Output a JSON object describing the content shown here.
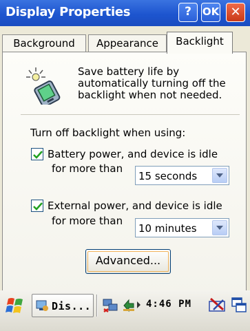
{
  "window": {
    "title": "Display Properties",
    "help_label": "?",
    "ok_label": "OK",
    "close_label": "✕"
  },
  "tabs": [
    {
      "label": "Background",
      "active": false
    },
    {
      "label": "Appearance",
      "active": false
    },
    {
      "label": "Backlight",
      "active": true
    }
  ],
  "backlight": {
    "description": "Save battery life by automatically turning off the backlight when not needed.",
    "section_label": "Turn off backlight when using:",
    "battery": {
      "checked": true,
      "label": "Battery power, and device is idle",
      "for_label": "for more than",
      "selected": "15 seconds"
    },
    "external": {
      "checked": true,
      "label": "External power, and device is idle",
      "for_label": "for more than",
      "selected": "10 minutes"
    },
    "advanced_label": "Advanced..."
  },
  "taskbar": {
    "task_label": "Dis...",
    "clock": "4:46 PM",
    "icons": [
      "start-flag-icon",
      "display-task-icon",
      "network-tray-icon",
      "sync-tray-icon",
      "keyboard-icon",
      "windows-icon"
    ]
  },
  "colors": {
    "titlebar": "#1d55cf",
    "checkmark": "#21a121",
    "close_button": "#c93a18"
  }
}
